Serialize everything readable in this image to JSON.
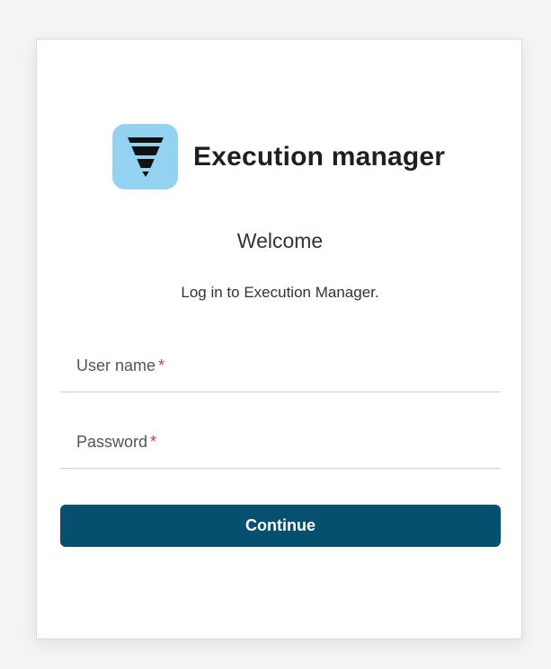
{
  "brand": {
    "name": "Execution manager",
    "icon": "funnel-icon",
    "tile_color": "#93d3f1"
  },
  "login": {
    "heading": "Welcome",
    "subtitle": "Log in to Execution Manager.",
    "username_label": "User name",
    "password_label": "Password",
    "required_marker": "*",
    "continue_label": "Continue"
  },
  "colors": {
    "button": "#06506f",
    "required": "#d9413c"
  }
}
